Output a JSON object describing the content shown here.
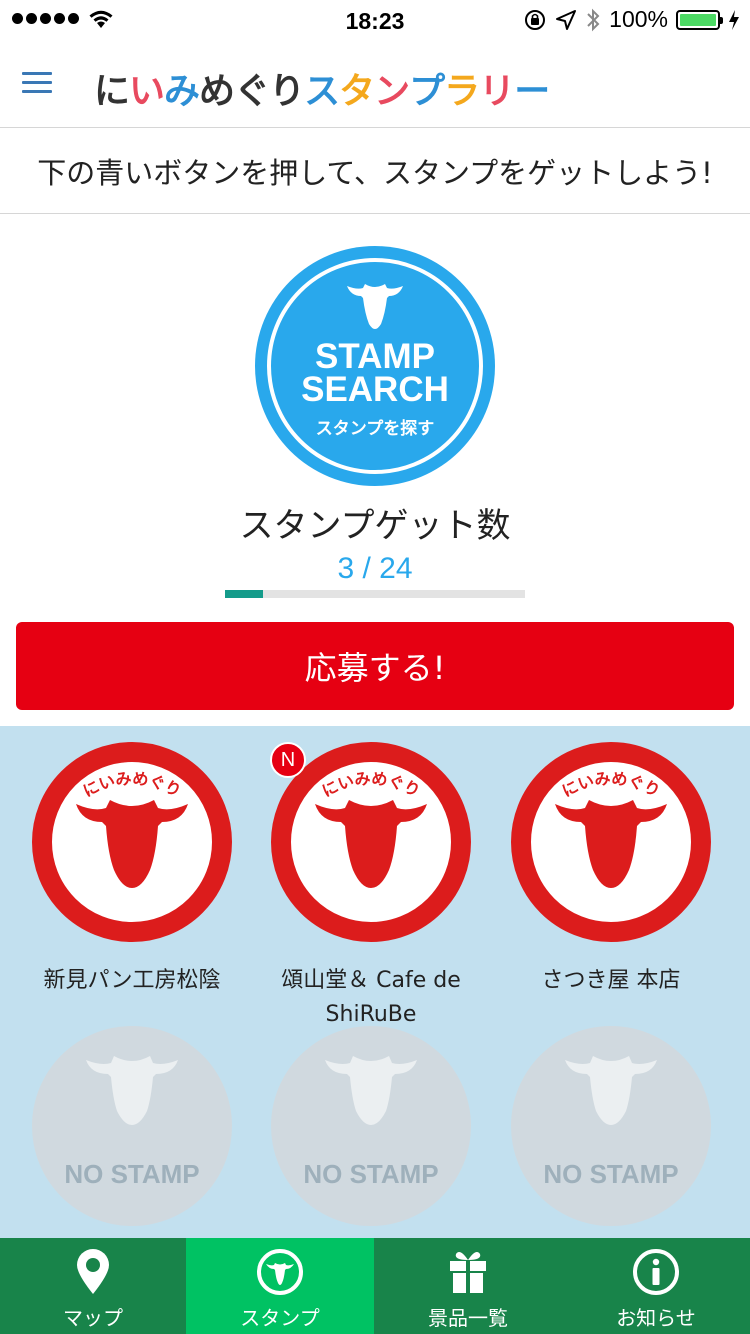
{
  "status_bar": {
    "time": "18:23",
    "battery": "100%"
  },
  "header": {
    "title": "にいみめぐりスタンプラリー",
    "title_chars": [
      {
        "ch": "に",
        "color": "#333333"
      },
      {
        "ch": "い",
        "color": "#e84a5f"
      },
      {
        "ch": "み",
        "color": "#2d8fd5"
      },
      {
        "ch": "め",
        "color": "#333333"
      },
      {
        "ch": "ぐ",
        "color": "#333333"
      },
      {
        "ch": "り",
        "color": "#333333"
      },
      {
        "ch": "ス",
        "color": "#2d8fd5"
      },
      {
        "ch": "タ",
        "color": "#f4a81d"
      },
      {
        "ch": "ン",
        "color": "#e84a5f"
      },
      {
        "ch": "プ",
        "color": "#2d8fd5"
      },
      {
        "ch": "ラ",
        "color": "#f4a81d"
      },
      {
        "ch": "リ",
        "color": "#e84a5f"
      },
      {
        "ch": "ー",
        "color": "#2d8fd5"
      }
    ]
  },
  "instruction": "下の青いボタンを押して、スタンプをゲットしよう!",
  "stamp_search": {
    "line1": "STAMP",
    "line2": "SEARCH",
    "sub": "スタンプを探す",
    "color": "#29a8ec"
  },
  "count": {
    "label": "スタンプゲット数",
    "value": "3 / 24",
    "progress": 0.125
  },
  "apply_button": "応募する!",
  "stamps": [
    {
      "name": "新見パン工房松陰",
      "status": "got",
      "arc": "にいみめぐり",
      "is_new": false
    },
    {
      "name": "頌山堂＆ Cafe de ShiRuBe",
      "status": "got",
      "arc": "にいみめぐり",
      "is_new": true,
      "badge": "N"
    },
    {
      "name": "さつき屋 本店",
      "status": "got",
      "arc": "にいみめぐり",
      "is_new": false
    },
    {
      "name": "",
      "status": "none",
      "label": "NO STAMP"
    },
    {
      "name": "",
      "status": "none",
      "label": "NO STAMP"
    },
    {
      "name": "",
      "status": "none",
      "label": "NO STAMP"
    }
  ],
  "tabs": [
    {
      "label": "マップ",
      "icon": "map-pin-icon",
      "active": false
    },
    {
      "label": "スタンプ",
      "icon": "stamp-icon",
      "active": true
    },
    {
      "label": "景品一覧",
      "icon": "gift-icon",
      "active": false
    },
    {
      "label": "お知らせ",
      "icon": "info-icon",
      "active": false
    }
  ],
  "colors": {
    "brand_red": "#e60012",
    "tab_green": "#18844a",
    "tab_active": "#00c263",
    "stamp_red": "#dc1c1c",
    "stamp_area_bg": "#c2e0ef"
  }
}
